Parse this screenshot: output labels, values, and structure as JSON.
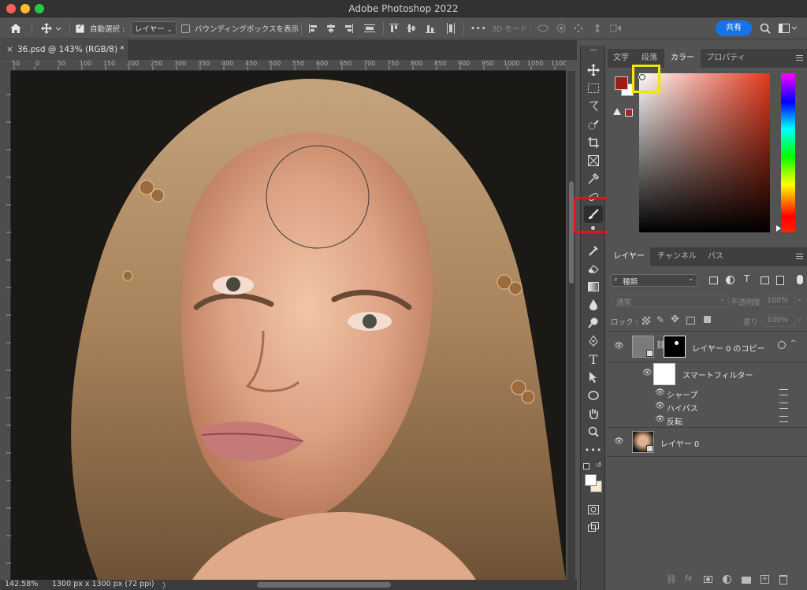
{
  "app": {
    "window_title": "Adobe Photoshop 2022"
  },
  "options_bar": {
    "auto_select_label": "自動選択 :",
    "auto_select_target": "レイヤー",
    "show_bbox_label": "バウンディングボックスを表示",
    "mode_3d_label": "3D モード :",
    "more": "•••",
    "share_label": "共有"
  },
  "document": {
    "tab_title": "36.psd @ 143% (RGB/8) *",
    "close_glyph": "×"
  },
  "ruler": {
    "ticks": [
      "50",
      "0",
      "50",
      "100",
      "150",
      "200",
      "250",
      "300",
      "350",
      "400",
      "450",
      "500",
      "550",
      "600",
      "650",
      "700",
      "750",
      "800",
      "850",
      "900",
      "950",
      "1000",
      "1050",
      "1100"
    ]
  },
  "status": {
    "zoom": "142.58%",
    "doc_size": "1300 px x 1300 px (72 ppi)",
    "arrow": "〉"
  },
  "color_panel": {
    "tabs": [
      "文字",
      "段落",
      "カラー",
      "プロパティ"
    ],
    "active_tab": "カラー",
    "foreground": "#9a1e16",
    "background": "#ffffff",
    "field_hue": "#e2381b"
  },
  "layers_panel": {
    "tabs": [
      "レイヤー",
      "チャンネル",
      "パス"
    ],
    "active_tab": "レイヤー",
    "filter_kind": "種類",
    "blend_mode": "通常",
    "opacity_label": "不透明度 :",
    "opacity_value": "100%",
    "lock_label": "ロック :",
    "fill_label": "塗り :",
    "fill_value": "100%",
    "layers": [
      {
        "name": "レイヤー 0 のコピー"
      },
      {
        "name": "スマートフィルター"
      },
      {
        "name": "シャープ"
      },
      {
        "name": "ハイパス"
      },
      {
        "name": "反転"
      },
      {
        "name": "レイヤー 0"
      }
    ],
    "footer_fx": "fx"
  }
}
